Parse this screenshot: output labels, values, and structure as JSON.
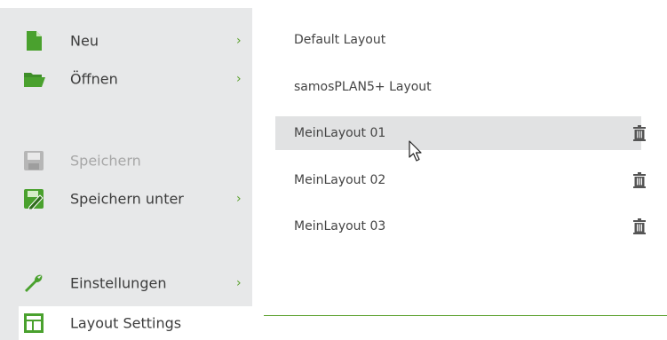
{
  "menu": {
    "items": [
      {
        "label": "Neu",
        "icon": "new-document-icon",
        "has_submenu": true,
        "state": "normal"
      },
      {
        "label": "Öffnen",
        "icon": "folder-open-icon",
        "has_submenu": true,
        "state": "normal"
      },
      {
        "label": "Speichern",
        "icon": "save-icon",
        "has_submenu": false,
        "state": "disabled"
      },
      {
        "label": "Speichern unter",
        "icon": "save-as-icon",
        "has_submenu": true,
        "state": "normal"
      },
      {
        "label": "Einstellungen",
        "icon": "wrench-icon",
        "has_submenu": true,
        "state": "normal"
      },
      {
        "label": "Layout Settings",
        "icon": "layout-settings-icon",
        "has_submenu": false,
        "state": "selected"
      }
    ],
    "chevron": "›"
  },
  "layouts": {
    "items": [
      {
        "label": "Default Layout",
        "deletable": false,
        "hovered": false
      },
      {
        "label": "samosPLAN5+ Layout",
        "deletable": false,
        "hovered": false
      },
      {
        "label": "MeinLayout 01",
        "deletable": true,
        "hovered": true
      },
      {
        "label": "MeinLayout 02",
        "deletable": true,
        "hovered": false
      },
      {
        "label": "MeinLayout 03",
        "deletable": true,
        "hovered": false
      }
    ]
  },
  "colors": {
    "accent_green": "#5aa02c",
    "sidebar_bg": "#e7e8e9",
    "hover_bg": "#e1e2e3"
  }
}
